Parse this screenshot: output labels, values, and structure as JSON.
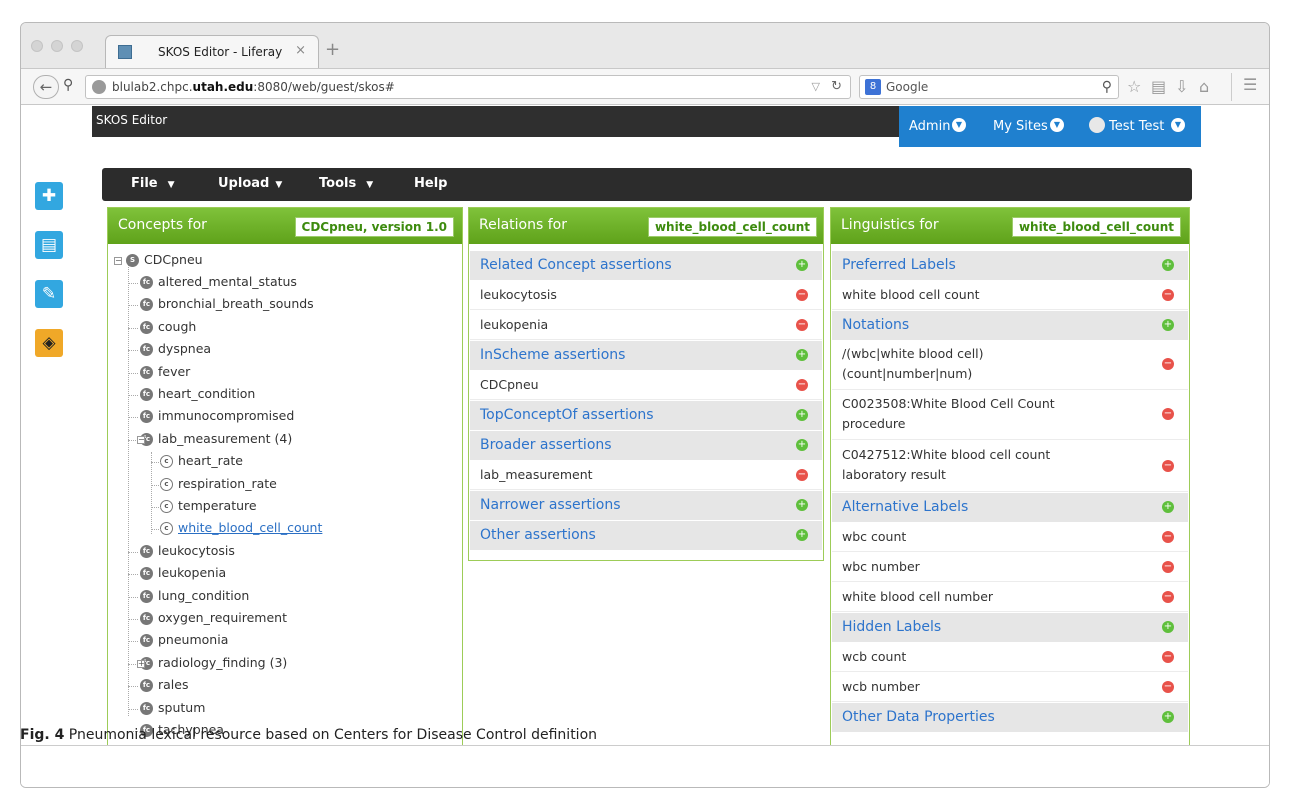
{
  "browser": {
    "tab_title": "SKOS Editor - Liferay",
    "tab_close": "×",
    "new_tab": "+",
    "url_prefix": "blulab2.chpc.",
    "url_bold": "utah.edu",
    "url_suffix": ":8080/web/guest/skos#",
    "search_engine_badge": "8",
    "search_placeholder": "Google"
  },
  "portal": {
    "title": "SKOS Editor",
    "admin": "Admin",
    "my_sites": "My Sites",
    "user": "Test Test"
  },
  "menubar": {
    "file": "File",
    "upload": "Upload",
    "tools": "Tools",
    "help": "Help"
  },
  "concepts_panel": {
    "title": "Concepts for",
    "tag": "CDCpneu, version 1.0",
    "root": "CDCpneu",
    "items": [
      "altered_mental_status",
      "bronchial_breath_sounds",
      "cough",
      "dyspnea",
      "fever",
      "heart_condition",
      "immunocompromised",
      "lab_measurement (4)",
      "heart_rate",
      "respiration_rate",
      "temperature",
      "white_blood_cell_count",
      "leukocytosis",
      "leukopenia",
      "lung_condition",
      "oxygen_requirement",
      "pneumonia",
      "radiology_finding (3)",
      "rales",
      "sputum",
      "tachypnea"
    ]
  },
  "relations_panel": {
    "title": "Relations for",
    "tag": "white_blood_cell_count",
    "related_title": "Related Concept assertions",
    "related_items": [
      "leukocytosis",
      "leukopenia"
    ],
    "inscheme_title": "InScheme assertions",
    "inscheme_items": [
      "CDCpneu"
    ],
    "topconcept_title": "TopConceptOf assertions",
    "broader_title": "Broader assertions",
    "broader_items": [
      "lab_measurement"
    ],
    "narrower_title": "Narrower assertions",
    "other_title": "Other assertions"
  },
  "linguistics_panel": {
    "title": "Linguistics for",
    "tag": "white_blood_cell_count",
    "preferred_title": "Preferred Labels",
    "preferred_items": [
      "white blood cell count"
    ],
    "notations_title": "Notations",
    "notation_items": [
      [
        "/(wbc|white blood cell)",
        "(count|number|num)"
      ],
      [
        "C0023508:White Blood Cell Count",
        "procedure"
      ],
      [
        "C0427512:White blood cell count",
        "laboratory result"
      ]
    ],
    "alternative_title": "Alternative Labels",
    "alternative_items": [
      "wbc count",
      "wbc number",
      "white blood cell number"
    ],
    "hidden_title": "Hidden Labels",
    "hidden_items": [
      "wcb count",
      "wcb number"
    ],
    "other_title": "Other Data Properties"
  },
  "caption": {
    "label": "Fig. 4",
    "text": "Pneumonia lexical resource based on Centers for Disease Control definition"
  }
}
